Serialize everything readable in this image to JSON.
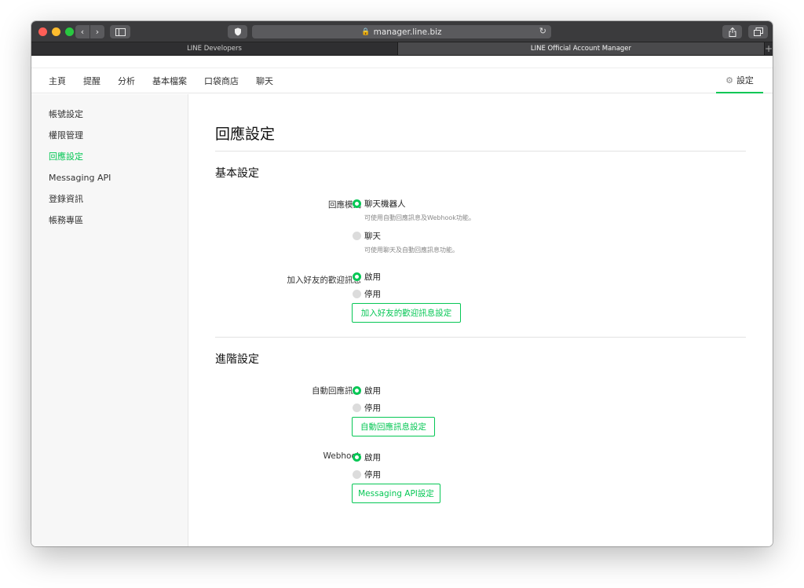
{
  "browser": {
    "url": "manager.line.biz",
    "tabs": [
      {
        "label": "LINE Developers",
        "active": false
      },
      {
        "label": "LINE Official Account Manager",
        "active": true
      }
    ],
    "new_tab": "+"
  },
  "nav": {
    "items": [
      "主頁",
      "提醒",
      "分析",
      "基本檔案",
      "口袋商店",
      "聊天"
    ],
    "settings_label": "設定"
  },
  "sidebar": {
    "items": [
      {
        "label": "帳號設定",
        "active": false
      },
      {
        "label": "權限管理",
        "active": false
      },
      {
        "label": "回應設定",
        "active": true
      },
      {
        "label": "Messaging API",
        "active": false
      },
      {
        "label": "登錄資訊",
        "active": false
      },
      {
        "label": "帳務專區",
        "active": false
      }
    ]
  },
  "main": {
    "title": "回應設定",
    "basic": {
      "title": "基本設定",
      "response_mode": {
        "label": "回應模式",
        "options": [
          {
            "label": "聊天機器人",
            "hint": "可使用自動回應訊息及Webhook功能。",
            "selected": true
          },
          {
            "label": "聊天",
            "hint": "可使用聊天及自動回應訊息功能。",
            "selected": false
          }
        ]
      },
      "welcome": {
        "label": "加入好友的歡迎訊息",
        "options": [
          {
            "label": "啟用",
            "selected": true
          },
          {
            "label": "停用",
            "selected": false
          }
        ],
        "button": "加入好友的歡迎訊息設定"
      }
    },
    "advanced": {
      "title": "進階設定",
      "auto_reply": {
        "label": "自動回應訊息",
        "options": [
          {
            "label": "啟用",
            "selected": true
          },
          {
            "label": "停用",
            "selected": false
          }
        ],
        "button": "自動回應訊息設定"
      },
      "webhook": {
        "label": "Webhook",
        "options": [
          {
            "label": "啟用",
            "selected": true
          },
          {
            "label": "停用",
            "selected": false
          }
        ],
        "button": "Messaging API設定"
      }
    }
  },
  "colors": {
    "accent": "#06c755",
    "titlebar": "#3b3b3d",
    "sidebar_bg": "#f7f7f7"
  }
}
